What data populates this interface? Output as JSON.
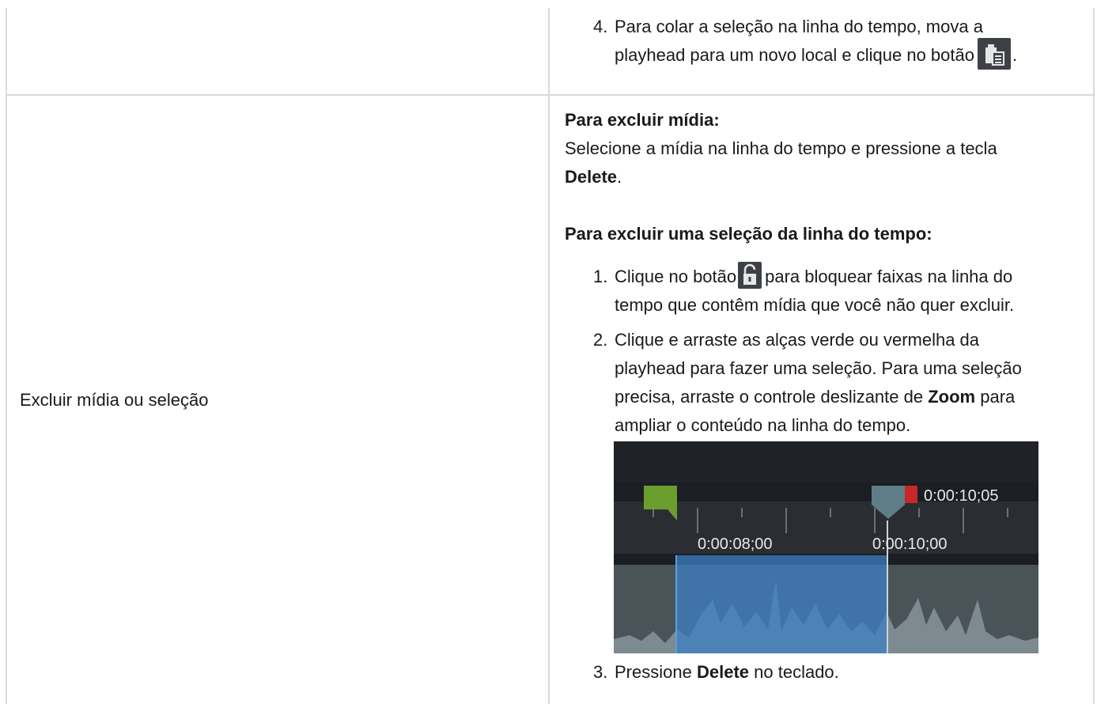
{
  "top_row": {
    "step4_number": "4.",
    "step4_line1": "Para colar a seleção na linha do tempo, mova a",
    "step4_line2": "playhead para um novo local e clique no botão",
    "step4_end": "."
  },
  "row": {
    "left_label": "Excluir mídia ou seleção",
    "section1_heading": "Para excluir mídia:",
    "section1_text": "Selecione a mídia na linha do tempo e pressione a tecla",
    "section1_key": "Delete",
    "section1_end": ".",
    "section2_heading": "Para excluir uma seleção da linha do tempo:",
    "steps": {
      "s1_number": "1.",
      "s1_a": "Clique no botão",
      "s1_b": "para bloquear faixas na linha do",
      "s1_c": "tempo que contêm mídia que você não quer excluir.",
      "s2_number": "2.",
      "s2_a": "Clique e arraste as alças verde ou vermelha da",
      "s2_b": "playhead para fazer uma seleção. Para uma seleção",
      "s2_c": "precisa, arraste o controle deslizante de",
      "s2_zoom": "Zoom",
      "s2_d": "para",
      "s2_e": "ampliar o conteúdo na linha do tempo.",
      "s3_number": "3.",
      "s3_a": "Pressione",
      "s3_key": "Delete",
      "s3_b": "no teclado."
    }
  },
  "timeline_image": {
    "playhead_time": "0:00:10;05",
    "ruler_label_1": "0:00:08;00",
    "ruler_label_2": "0:00:10;00",
    "colors": {
      "background": "#1f2327",
      "ruler": "#2a2e33",
      "selection": "#3e7fc4",
      "start_handle": "#6a9e2e",
      "end_handle": "#c8282a",
      "playhead": "#5d7e86"
    }
  }
}
